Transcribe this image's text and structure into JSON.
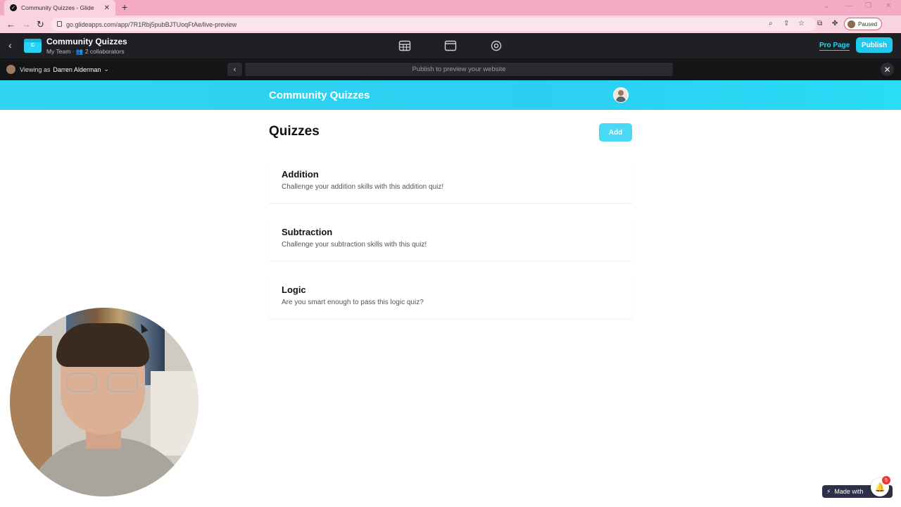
{
  "browser": {
    "tab_title": "Community Quizzes - Glide",
    "tab_close": "✕",
    "new_tab": "+",
    "url": "go.glideapps.com/app/7R1Rbj5pubBJTUoqFtAe/live-preview",
    "profile_status": "Paused"
  },
  "builder": {
    "app_icon_letter": "C",
    "app_name": "Community Quizzes",
    "team_info": "My Team · 👥 2 collaborators",
    "pro_page": "Pro Page",
    "publish": "Publish"
  },
  "preview_bar": {
    "viewing_as_label": "Viewing as",
    "viewing_as_user": "Darren Alderman",
    "url_placeholder": "Publish to preview your website"
  },
  "app": {
    "title": "Community Quizzes",
    "page_title": "Quizzes",
    "add_label": "Add",
    "quizzes": [
      {
        "title": "Addition",
        "description": "Challenge your addition skills with this addition quiz!"
      },
      {
        "title": "Subtraction",
        "description": "Challenge your subtraction skills with this quiz!"
      },
      {
        "title": "Logic",
        "description": "Are you smart enough to pass this logic quiz?"
      }
    ]
  },
  "footer": {
    "made_with": "Made with",
    "notification_count": "5"
  },
  "colors": {
    "accent": "#2cd3f2",
    "builder_bg": "#1f2024",
    "browser_bg": "#f4a9c4"
  }
}
